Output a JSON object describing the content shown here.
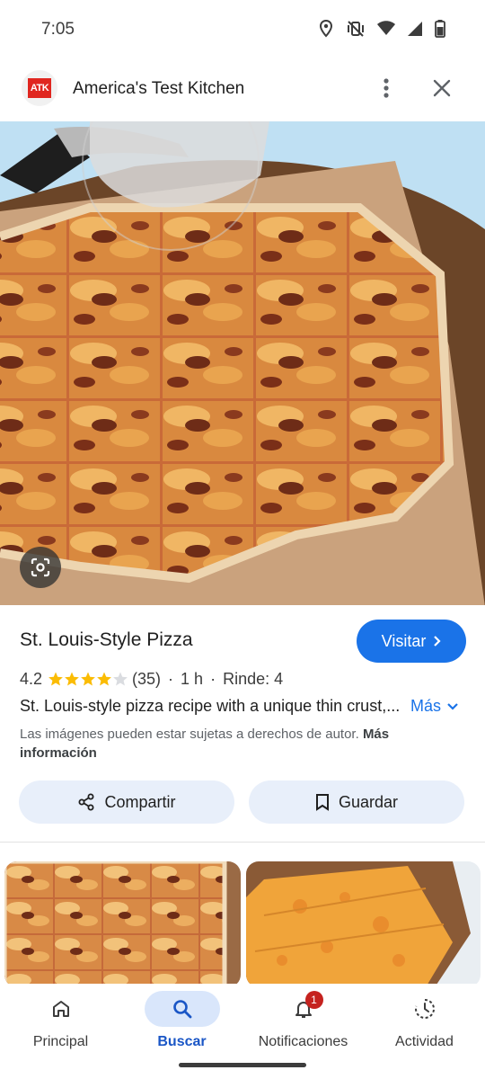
{
  "status_bar": {
    "time": "7:05",
    "icons": [
      "location-icon",
      "vibrate-off-icon",
      "wifi-icon",
      "signal-icon",
      "battery-icon"
    ]
  },
  "source": {
    "logo_text": "ATK",
    "name": "America's Test Kitchen",
    "logo_color": "#e0261f"
  },
  "result": {
    "title": "St. Louis-Style Pizza",
    "visit_label": "Visitar",
    "rating": "4.2",
    "stars_filled": 4.2,
    "reviews": "(35)",
    "time": "1 h",
    "yield": "Rinde: 4",
    "description": "St. Louis-style pizza recipe with a unique thin crust,...",
    "more_label": "Más",
    "copyright_text": "Las imágenes pueden estar sujetas a derechos de autor.",
    "copyright_link": "Más información"
  },
  "actions": {
    "share_label": "Compartir",
    "save_label": "Guardar"
  },
  "nav": {
    "items": [
      {
        "label": "Principal",
        "icon": "home-icon"
      },
      {
        "label": "Buscar",
        "icon": "search-icon",
        "active": true
      },
      {
        "label": "Notificaciones",
        "icon": "bell-icon",
        "badge": "1"
      },
      {
        "label": "Actividad",
        "icon": "activity-icon"
      }
    ]
  },
  "colors": {
    "accent": "#1a73e8",
    "star": "#fbbc04",
    "badge": "#c5221f",
    "chip_bg": "#e8effa"
  }
}
